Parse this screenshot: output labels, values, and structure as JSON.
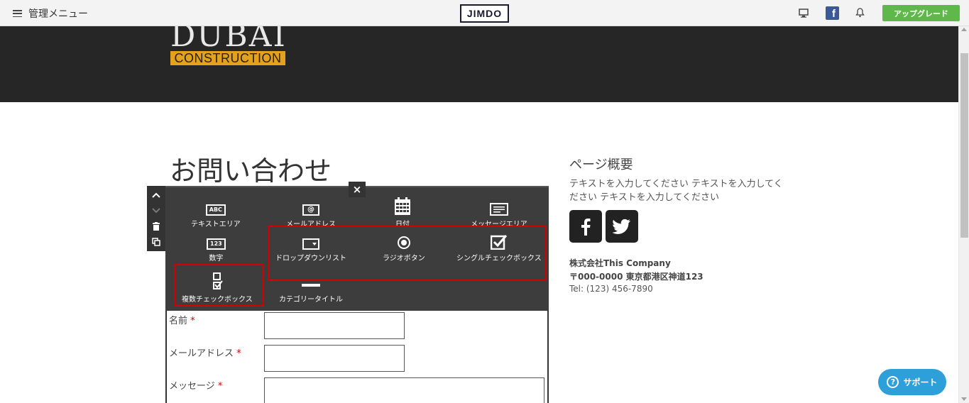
{
  "topbar": {
    "menu_label": "管理メニュー",
    "logo_text": "JIMDO",
    "upgrade_label": "アップグレード",
    "icons": [
      "desktop-icon",
      "facebook-icon",
      "bell-icon"
    ]
  },
  "header": {
    "site_name": "DUBAI",
    "site_tagline": "CONSTRUCTION",
    "accent_color": "#e6a11c"
  },
  "main": {
    "title": "お問い合わせ"
  },
  "tool_strip": {
    "icons": [
      "chevron-up-icon",
      "chevron-down-icon",
      "trash-icon",
      "copy-icon"
    ]
  },
  "panel": {
    "close_label": "×",
    "tools": [
      {
        "label": "テキストエリア",
        "icon": "abc-icon"
      },
      {
        "label": "メールアドレス",
        "icon": "at-icon"
      },
      {
        "label": "日付",
        "icon": "calendar-icon"
      },
      {
        "label": "メッセージエリア",
        "icon": "message-area-icon"
      },
      {
        "label": "数字",
        "icon": "number-icon"
      },
      {
        "label": "ドロップダウンリスト",
        "icon": "dropdown-icon"
      },
      {
        "label": "ラジオボタン",
        "icon": "radio-icon"
      },
      {
        "label": "シングルチェックボックス",
        "icon": "checkbox-icon"
      },
      {
        "label": "複数チェックボックス",
        "icon": "multi-checkbox-icon"
      },
      {
        "label": "カテゴリータイトル",
        "icon": "category-title-icon"
      }
    ],
    "ab_abc": "ABC",
    "ab_at": "@",
    "ab_num": "123"
  },
  "form": {
    "fields": [
      {
        "label": "名前",
        "required": "*"
      },
      {
        "label": "メールアドレス",
        "required": "*"
      },
      {
        "label": "メッセージ",
        "required": "*"
      }
    ]
  },
  "sidebar": {
    "title": "ページ概要",
    "text": "テキストを入力してください テキストを入力してください テキストを入力してください",
    "company": "株式会社This Company",
    "address": "〒000-0000 東京都港区神道123",
    "tel": "Tel: (123) 456-7890"
  },
  "support": {
    "label": "サポート",
    "q": "?",
    "color": "#2d9fd9"
  }
}
